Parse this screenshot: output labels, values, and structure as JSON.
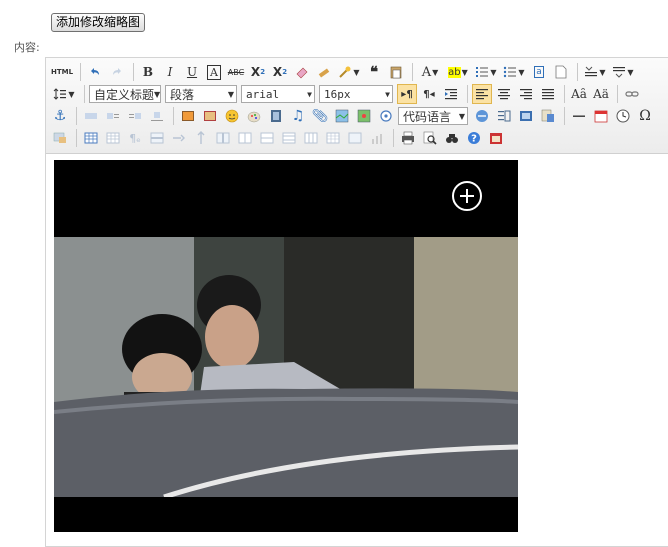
{
  "form": {
    "add_thumbnail_button": "添加修改缩略图",
    "content_label": "内容:"
  },
  "editor": {
    "toolbar": {
      "html_label": "HTML",
      "custom_heading": "自定义标题",
      "paragraph": "段落",
      "font_family": "arial",
      "font_size": "16px",
      "code_language": "代码语言"
    }
  },
  "colors": {
    "active_button": "#fbe2a4",
    "help_icon": "#3b7dd8",
    "video_bg": "#000000"
  }
}
